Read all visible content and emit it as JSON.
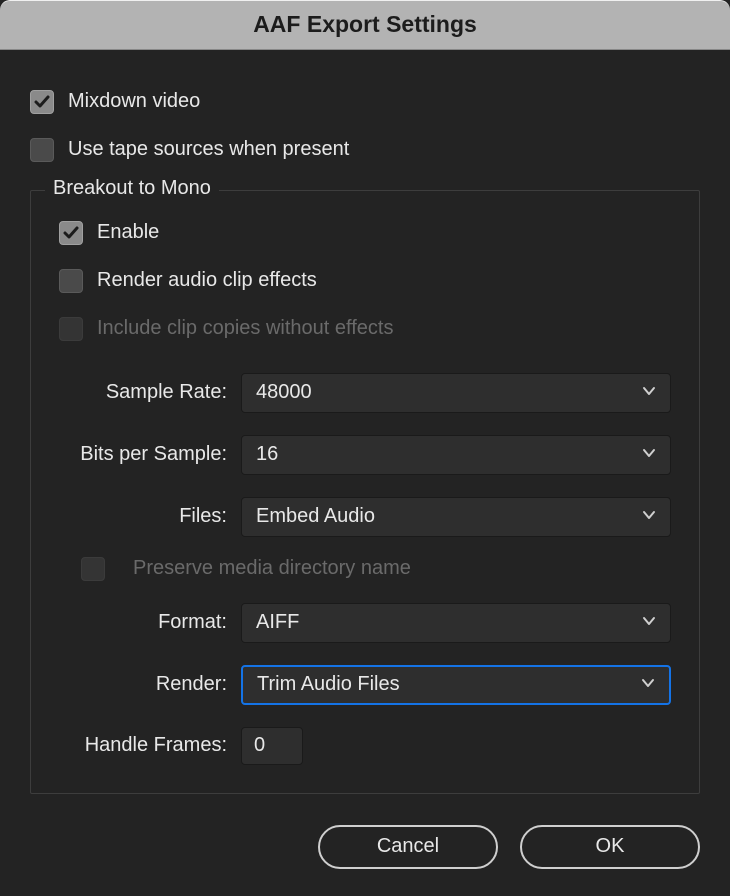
{
  "titlebar": {
    "title": "AAF Export Settings"
  },
  "options": {
    "mixdown_video_label": "Mixdown video",
    "mixdown_video_checked": true,
    "use_tape_sources_label": "Use tape sources when present",
    "use_tape_sources_checked": false
  },
  "breakout": {
    "legend": "Breakout to Mono",
    "enable_label": "Enable",
    "enable_checked": true,
    "render_effects_label": "Render audio clip effects",
    "render_effects_checked": false,
    "include_copies_label": "Include clip copies without effects",
    "include_copies_checked": false,
    "include_copies_disabled": true,
    "sample_rate": {
      "label": "Sample Rate:",
      "value": "48000"
    },
    "bits_per_sample": {
      "label": "Bits per Sample:",
      "value": "16"
    },
    "files": {
      "label": "Files:",
      "value": "Embed Audio"
    },
    "preserve_dir_label": "Preserve media directory name",
    "preserve_dir_checked": false,
    "preserve_dir_disabled": true,
    "format": {
      "label": "Format:",
      "value": "AIFF"
    },
    "render": {
      "label": "Render:",
      "value": "Trim Audio Files"
    },
    "handle_frames": {
      "label": "Handle Frames:",
      "value": "0"
    }
  },
  "footer": {
    "cancel_label": "Cancel",
    "ok_label": "OK"
  }
}
